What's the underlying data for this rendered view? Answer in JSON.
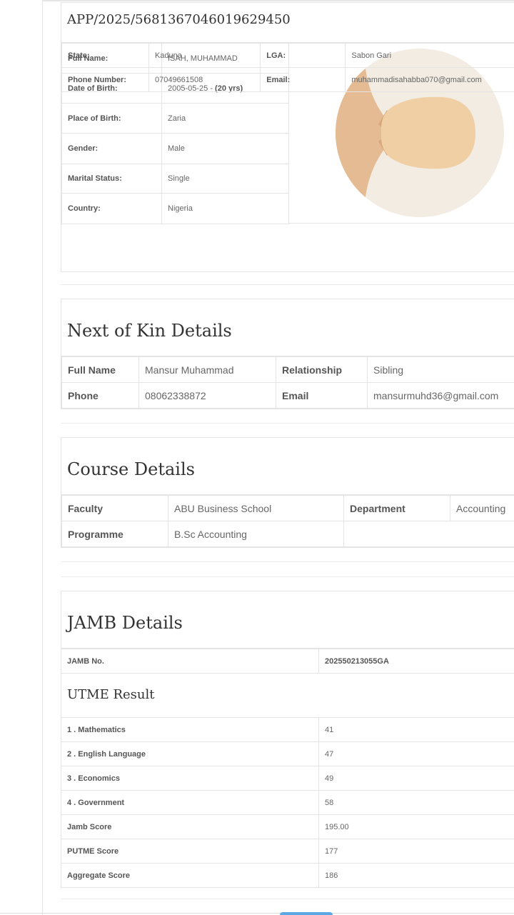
{
  "application": {
    "id": "APP/2025/5681367046019629450"
  },
  "personal": {
    "fields": [
      {
        "label": "Full Name:",
        "value": "ISAH, MUHAMMAD"
      },
      {
        "label": "Date of Birth:",
        "value": "2005-05-25 - ",
        "value_bold": "(20 yrs)"
      },
      {
        "label": "Place of Birth:",
        "value": "Zaria"
      },
      {
        "label": "Gender:",
        "value": "Male"
      },
      {
        "label": "Marital Status:",
        "value": "Single"
      },
      {
        "label": "Country:",
        "value": "Nigeria"
      }
    ],
    "state_label": "State:",
    "state_value": "Kaduna",
    "lga_label": "LGA:",
    "lga_value": "Sabon Gari",
    "phone_label": "Phone Number:",
    "phone_value": "07049661508",
    "email_label": "Email:",
    "email_value": "muhammadisahabba070@gmail.com"
  },
  "next_of_kin": {
    "title": "Next of Kin Details",
    "full_name_label": "Full Name",
    "full_name_value": "Mansur Muhammad",
    "relationship_label": "Relationship",
    "relationship_value": "Sibling",
    "phone_label": "Phone",
    "phone_value": "08062338872",
    "email_label": "Email",
    "email_value": "mansurmuhd36@gmail.com"
  },
  "course": {
    "title": "Course Details",
    "faculty_label": "Faculty",
    "faculty_value": "ABU Business School",
    "department_label": "Department",
    "department_value": "Accounting",
    "programme_label": "Programme",
    "programme_value": "B.Sc Accounting"
  },
  "jamb": {
    "title": "JAMB Details",
    "jamb_no_label": "JAMB No.",
    "jamb_no_value": "202550213055GA",
    "utme_title": "UTME Result",
    "results": [
      {
        "subject": "1 . Mathematics",
        "score": "41"
      },
      {
        "subject": "2 . English Language",
        "score": "47"
      },
      {
        "subject": "3 . Economics",
        "score": "49"
      },
      {
        "subject": "4 . Government",
        "score": "58"
      },
      {
        "subject": "Jamb Score",
        "score": "195.00"
      },
      {
        "subject": "PUTME Score",
        "score": "177"
      },
      {
        "subject": "Aggregate Score",
        "score": "186"
      }
    ]
  },
  "colors": {
    "border": "#e4e4e4",
    "avatar_bg": "#f3ece3",
    "avatar_skin": "#f0cfa4",
    "avatar_hair": "#e4bb92",
    "accent_blue": "#5aa9e6"
  }
}
